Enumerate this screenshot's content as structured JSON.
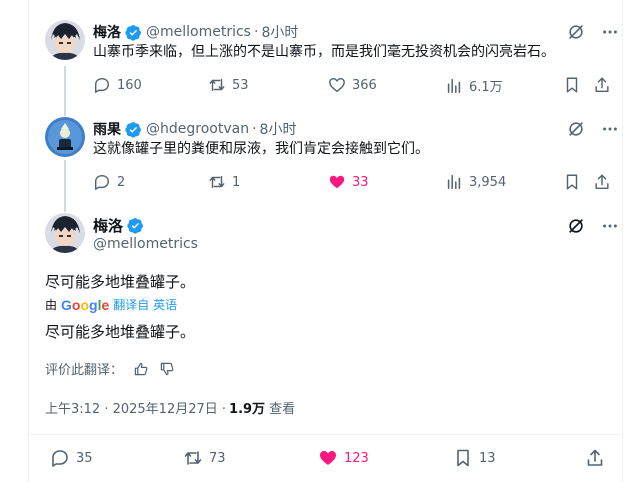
{
  "tweets": [
    {
      "name": "梅洛",
      "handle": "@mellometrics",
      "time": "8小时",
      "text": "山寨币季来临，但上涨的不是山寨币，而是我们毫无投资机会的闪亮岩石。",
      "replies": "160",
      "retweets": "53",
      "likes": "366",
      "views": "6.1万"
    },
    {
      "name": "雨果",
      "handle": "@hdegrootvan",
      "time": "8小时",
      "text": "这就像罐子里的粪便和尿液，我们肯定会接触到它们。",
      "replies": "2",
      "retweets": "1",
      "likes": "33",
      "views": "3,954"
    }
  ],
  "main": {
    "name": "梅洛",
    "handle": "@mellometrics",
    "original_text": "尽可能多地堆叠罐子。",
    "translated_by": "由",
    "google": "Google",
    "translated_from": "翻译自 英语",
    "translated_text": "尽可能多地堆叠罐子。",
    "rate_label": "评价此翻译：",
    "timestamp": "上午3:12 · 2025年12月27日 · ",
    "views_count": "1.9万",
    "views_label": "查看",
    "replies": "35",
    "retweets": "73",
    "likes": "123",
    "bookmarks": "13"
  },
  "colors": {
    "verified": "#1d9bf0",
    "like": "#f91880",
    "secondary": "#536471"
  }
}
